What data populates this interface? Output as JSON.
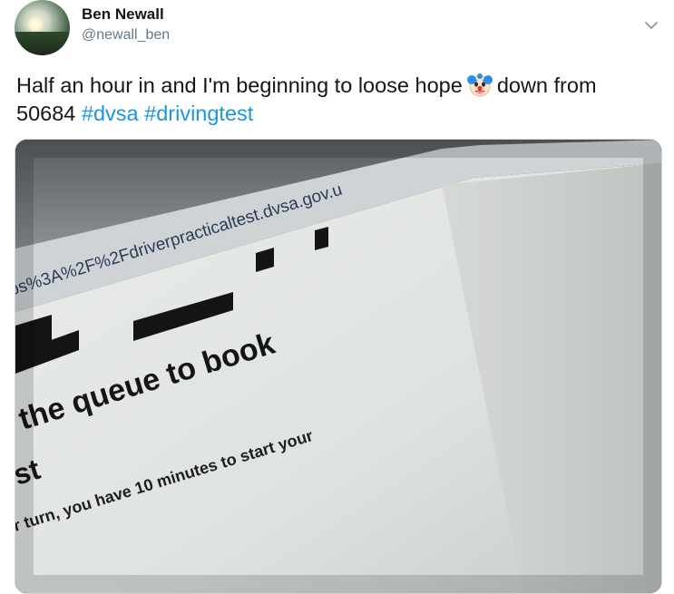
{
  "tweet": {
    "author_name": "Ben Newall",
    "author_handle": "@newall_ben",
    "text_part1": "Half an hour in and I'm beginning to loose hope",
    "emoji_icon": "clown-face-emoji",
    "text_part2": "down from",
    "text_part3": "50684",
    "hashtag_1": "#dvsa",
    "hashtag_2": "#drivingtest",
    "colors": {
      "hashtag": "#1b95e0",
      "handle": "#657786",
      "text": "#14171a"
    }
  },
  "photo": {
    "url_text": "ps%3A%2F%2Fdriverpracticaltest.dvsa.gov.u",
    "heading_line": "the queue to book",
    "heading_line2": "st",
    "body_line1": "you have 10 minutes to start your",
    "body_line2": "r turn, you have 10 minutes to start your"
  }
}
